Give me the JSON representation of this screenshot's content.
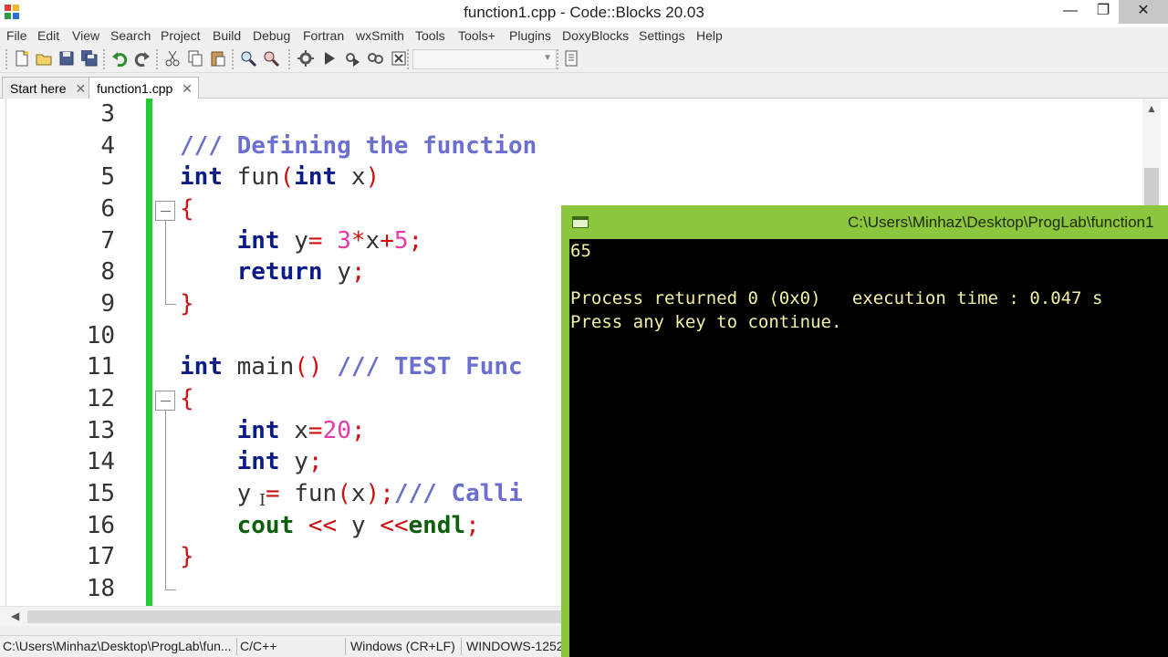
{
  "window": {
    "title": "function1.cpp - Code::Blocks 20.03",
    "minimize": "—",
    "maximize": "❐",
    "close": "✕"
  },
  "menu": [
    "File",
    "Edit",
    "View",
    "Search",
    "Project",
    "Build",
    "Debug",
    "Fortran",
    "wxSmith",
    "Tools",
    "Tools+",
    "Plugins",
    "DoxyBlocks",
    "Settings",
    "Help"
  ],
  "toolbar": {
    "icons": [
      "new-file-icon",
      "open-icon",
      "save-icon",
      "save-all-icon",
      "undo-icon",
      "redo-icon",
      "cut-icon",
      "copy-icon",
      "paste-icon",
      "find-icon",
      "replace-icon",
      "build-icon",
      "run-icon",
      "build-and-run-icon",
      "rebuild-icon",
      "abort-icon",
      "build-target-combo",
      "show-log-icon"
    ]
  },
  "tabs": [
    {
      "label": "Start here",
      "close": "✕"
    },
    {
      "label": "function1.cpp",
      "close": "✕"
    }
  ],
  "editor": {
    "line_numbers": [
      "3",
      "4",
      "5",
      "6",
      "7",
      "8",
      "9",
      "10",
      "11",
      "12",
      "13",
      "14",
      "15",
      "16",
      "17",
      "18"
    ],
    "code": {
      "l4_comment": "/// Defining the function",
      "l5_kw": "int",
      "l5_fn": " fun",
      "l5_po": "(",
      "l5_kw2": "int",
      "l5_arg": " x",
      "l5_pc": ")",
      "l6_brace": "{",
      "l7_indent": "    ",
      "l7_kw": "int",
      "l7_var": " y",
      "l7_eq": "= ",
      "l7_n1": "3",
      "l7_star": "*",
      "l7_x": "x",
      "l7_plus": "+",
      "l7_n2": "5",
      "l7_semi": ";",
      "l8_indent": "    ",
      "l8_kw": "return",
      "l8_var": " y",
      "l8_semi": ";",
      "l9_brace": "}",
      "l11_kw": "int",
      "l11_fn": " main",
      "l11_paren": "()",
      "l11_comment": " /// TEST Func",
      "l12_brace": "{",
      "l13_indent": "    ",
      "l13_kw": "int",
      "l13_var": " x",
      "l13_eq": "=",
      "l13_num": "20",
      "l13_semi": ";",
      "l14_indent": "    ",
      "l14_kw": "int",
      "l14_var": " y",
      "l14_semi": ";",
      "l15_indent": "    ",
      "l15_var": "y ",
      "l15_eq": "= ",
      "l15_fn": "fun",
      "l15_po": "(",
      "l15_x": "x",
      "l15_pc": ")",
      "l15_semi": ";",
      "l15_comment": "/// Calli",
      "l16_indent": "    ",
      "l16_cout": "cout",
      "l16_op1": " << ",
      "l16_y": "y ",
      "l16_op2": "<<",
      "l16_endl": "endl",
      "l16_semi": ";",
      "l17_brace": "}"
    },
    "caret_glyph": "I"
  },
  "console": {
    "title": "C:\\Users\\Minhaz\\Desktop\\ProgLab\\function1",
    "lines": [
      "65",
      "",
      "Process returned 0 (0x0)   execution time : 0.047 s",
      "Press any key to continue."
    ]
  },
  "statusbar": {
    "path": "C:\\Users\\Minhaz\\Desktop\\ProgLab\\fun...",
    "language": "C/C++",
    "eol": "Windows (CR+LF)",
    "encoding": "WINDOWS-1252"
  },
  "colors": {
    "console_frame": "#8cc63f",
    "console_text": "#f2f2a0",
    "change_bar": "#22cc33",
    "keyword": "#0b1b8a",
    "comment": "#6a6fd0",
    "number": "#e23aa8",
    "operator": "#cc1111"
  }
}
